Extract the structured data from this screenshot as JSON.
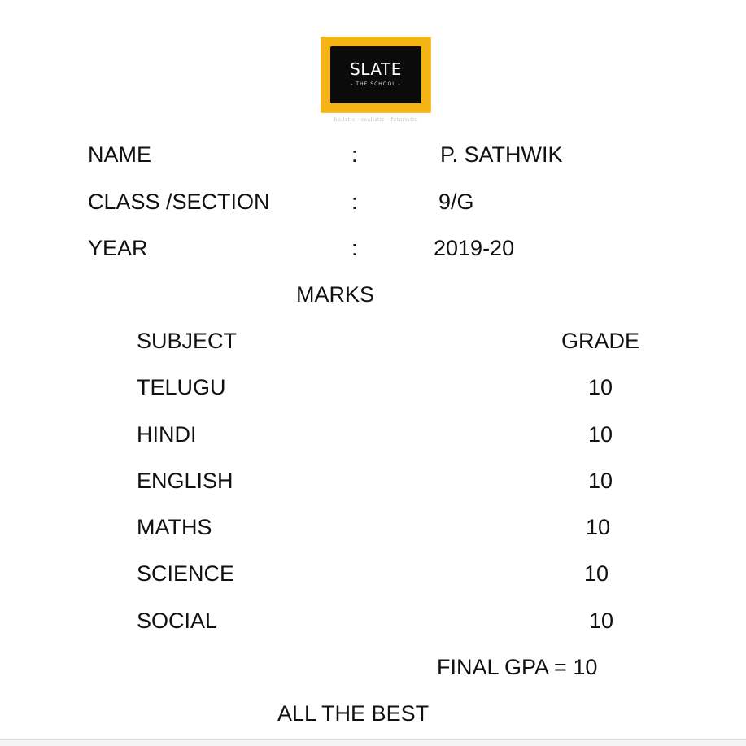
{
  "logo": {
    "name": "SLATE",
    "subtitle": "- THE SCHOOL -",
    "tagline": "holistic · realistic · futuristic"
  },
  "student": {
    "name_label": "NAME",
    "name_colon": ":",
    "name_value": "P. SATHWIK",
    "class_label": "CLASS /SECTION",
    "class_colon": ":",
    "class_value": "9/G",
    "year_label": "YEAR",
    "year_colon": ":",
    "year_value": "2019-20"
  },
  "marks": {
    "heading": "MARKS",
    "subject_header": "SUBJECT",
    "grade_header": "GRADE",
    "rows": [
      {
        "subject": "TELUGU",
        "grade": "10"
      },
      {
        "subject": "HINDI",
        "grade": "10"
      },
      {
        "subject": "ENGLISH",
        "grade": "10"
      },
      {
        "subject": "MATHS",
        "grade": "10"
      },
      {
        "subject": "SCIENCE",
        "grade": "10"
      },
      {
        "subject": "SOCIAL",
        "grade": "10"
      }
    ]
  },
  "final_gpa": "FINAL GPA = 10",
  "closing": "ALL THE BEST"
}
